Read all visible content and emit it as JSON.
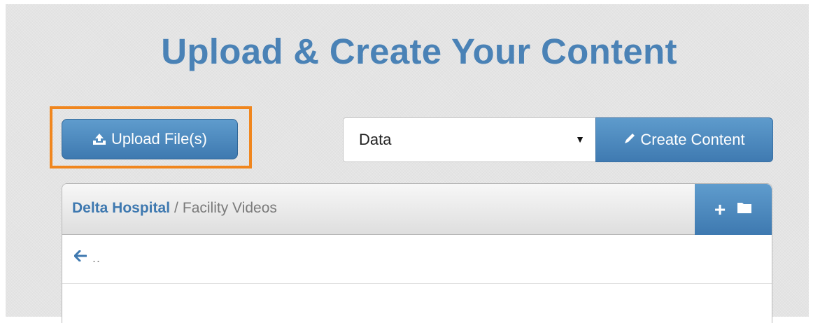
{
  "page": {
    "title": "Upload & Create Your Content"
  },
  "colors": {
    "title": "#4a82b6",
    "accent_button": "#4585be",
    "highlight": "#f0861e"
  },
  "toolbar": {
    "upload_label": "Upload File(s)",
    "upload_icon": "upload-icon",
    "content_type_selected": "Data",
    "create_label": "Create Content",
    "create_icon": "pencil-icon"
  },
  "file_panel": {
    "breadcrumb_root": "Delta Hospital",
    "breadcrumb_separator": "/",
    "breadcrumb_current": "Facility Videos",
    "new_folder_icons": [
      "plus-icon",
      "folder-icon"
    ],
    "back_icon": "arrow-left-icon",
    "parent_label": ".."
  }
}
